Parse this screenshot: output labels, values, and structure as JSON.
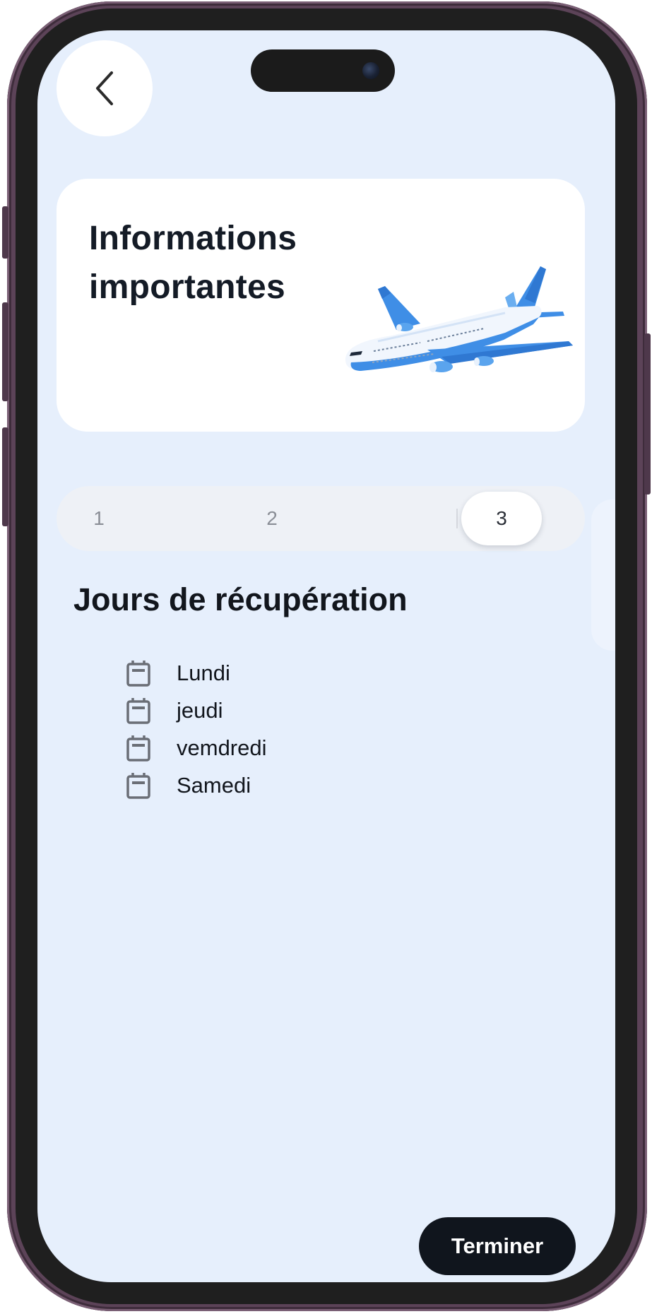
{
  "header": {
    "back_icon": "chevron-left-icon"
  },
  "hero": {
    "title": "Informations importantes",
    "illustration": "airplane-illustration"
  },
  "stepper": {
    "steps": [
      "1",
      "2",
      "3"
    ],
    "active_step": "3"
  },
  "section": {
    "title": "Jours de récupération",
    "day_icon": "calendar-icon",
    "days": [
      "Lundi",
      "jeudi",
      "vemdredi",
      "Samedi"
    ]
  },
  "footer": {
    "finish_label": "Terminer"
  },
  "colors": {
    "screen_bg": "#e6effc",
    "card_bg": "#ffffff",
    "primary_button": "#10151d",
    "accent_blue": "#3f8ee6"
  }
}
